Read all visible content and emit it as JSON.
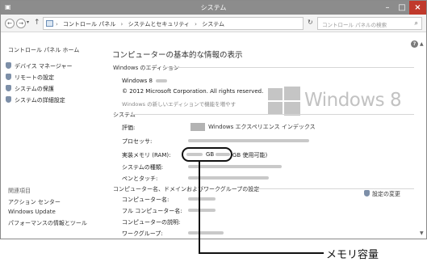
{
  "window": {
    "title": "システム",
    "minimize": "–",
    "maximize": "□",
    "close": "×"
  },
  "address": {
    "back": "←",
    "forward": "→",
    "up": "↑",
    "crumbs": [
      "コントロール パネル",
      "システムとセキュリティ",
      "システム"
    ],
    "separator": "›",
    "refresh": "↻",
    "search_placeholder": "コントロール パネルの検索",
    "search_icon": "⌕"
  },
  "sidebar": {
    "home": "コントロール パネル ホーム",
    "items": [
      "デバイス マネージャー",
      "リモートの設定",
      "システムの保護",
      "システムの詳細設定"
    ],
    "related_heading": "関連項目",
    "links": [
      "アクション センター",
      "Windows Update",
      "パフォーマンスの情報とツール"
    ]
  },
  "main": {
    "help": "?",
    "title": "コンピューターの基本的な情報の表示",
    "edition_section": "Windows のエディション",
    "edition_name": "Windows 8",
    "copyright": "© 2012 Microsoft Corporation. All rights reserved.",
    "new_edition_link": "Windows の新しいエディションで機能を増やす",
    "logo_text": "Windows 8",
    "system_section": "システム",
    "rating_label": "評価:",
    "rating_text": "Windows エクスペリエンス インデックス",
    "processor_label": "プロセッサ:",
    "ram_label": "実装メモリ (RAM):",
    "ram_unit": "GB",
    "ram_usable": "GB 使用可能)",
    "system_type_label": "システムの種類:",
    "pen_label": "ペンとタッチ:",
    "computer_section": "コンピューター名、ドメインおよびワークグループの設定",
    "computer_name_label": "コンピューター名:",
    "full_name_label": "フル コンピューター名:",
    "description_label": "コンピューターの説明:",
    "workgroup_label": "ワークグループ:",
    "change_settings": "設定の変更"
  },
  "callout": {
    "label": "メモリ容量"
  },
  "colors": {
    "titlebar": "#8c8c8c",
    "close": "#c0392b",
    "logo": "#c2c2c2"
  }
}
